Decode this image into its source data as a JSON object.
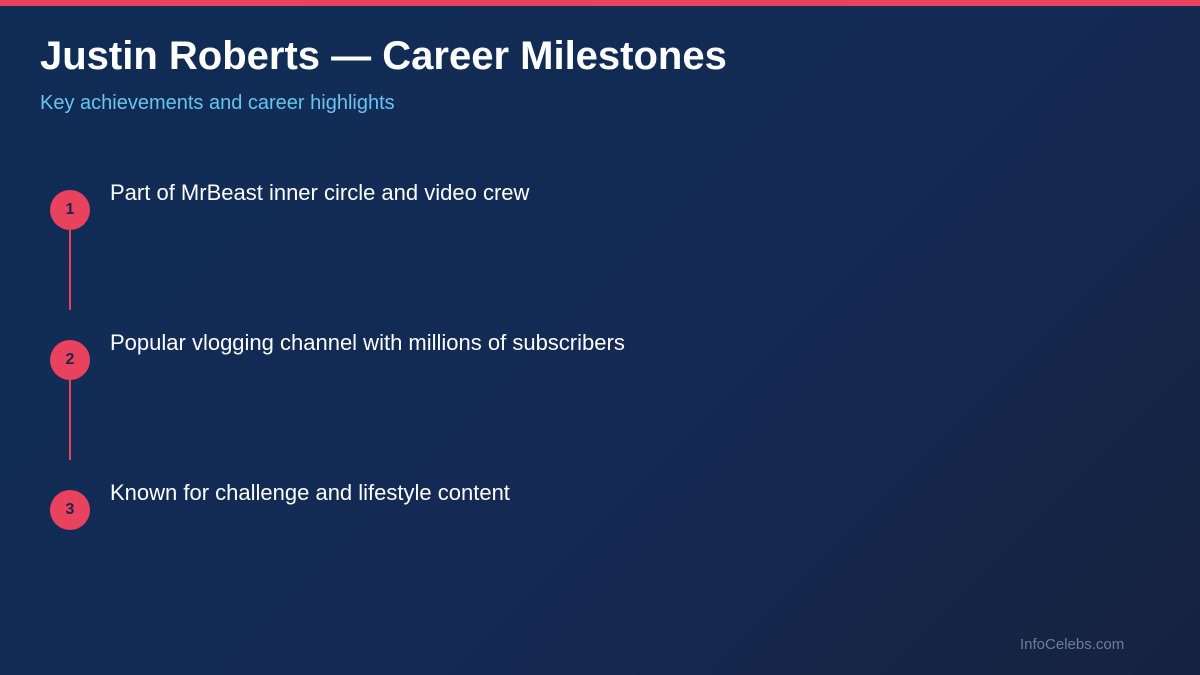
{
  "header": {
    "title": "Justin Roberts — Career Milestones",
    "subtitle": "Key achievements and career highlights"
  },
  "milestones": [
    {
      "number": "1",
      "text": "Part of MrBeast inner circle and video crew"
    },
    {
      "number": "2",
      "text": "Popular vlogging channel with millions of subscribers"
    },
    {
      "number": "3",
      "text": "Known for challenge and lifestyle content"
    }
  ],
  "footer": {
    "watermark": "InfoCelebs.com"
  },
  "colors": {
    "accent": "#e8425f",
    "subtitle": "#69c3f0",
    "background_start": "#0f2d55",
    "background_end": "#17223f"
  }
}
